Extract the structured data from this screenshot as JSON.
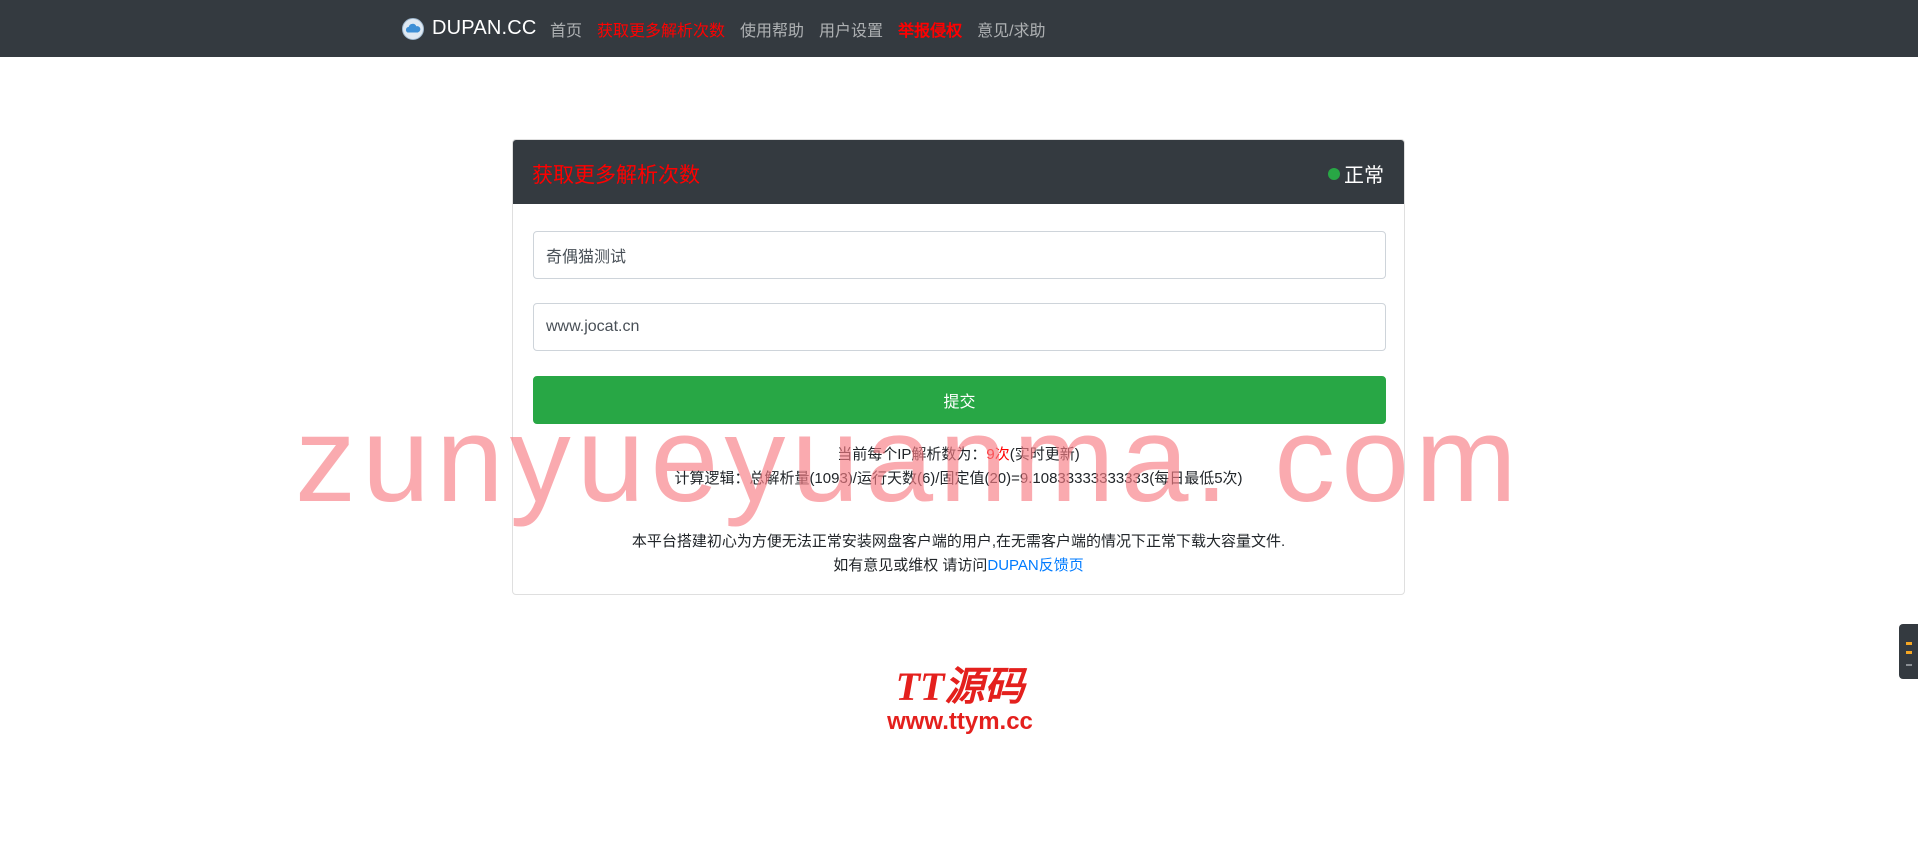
{
  "navbar": {
    "brand": "DUPAN.CC",
    "items": [
      {
        "label": "首页",
        "highlight": false
      },
      {
        "label": "获取更多解析次数",
        "highlight": true
      },
      {
        "label": "使用帮助",
        "highlight": false
      },
      {
        "label": "用户设置",
        "highlight": false
      },
      {
        "label": "举报侵权",
        "highlight": true
      },
      {
        "label": "意见/求助",
        "highlight": false
      }
    ]
  },
  "card": {
    "title": "获取更多解析次数",
    "status": "正常",
    "title_field_value": "奇偶猫测试",
    "url_field_value": "www.jocat.cn",
    "submit_label": "提交",
    "ip_line": {
      "prefix": "当前每个IP解析数为：",
      "count": "9次",
      "suffix": "(实时更新)"
    },
    "logic_line": "计算逻辑：总解析量(1093)/运行天数(6)/固定值(20)=9.10833333333333(每日最低5次)",
    "about_line": "本平台搭建初心为方便无法正常安装网盘客户端的用户,在无需客户端的情况下正常下载大容量文件.",
    "feedback": {
      "prefix": "如有意见或维权 请访问",
      "link_text": "DUPAN反馈页"
    }
  },
  "watermarks": {
    "overlay_text": "zunyueyuanma. com",
    "logo_main": "TT源码",
    "logo_url": "www.ttym.cc"
  },
  "colors": {
    "navbar_bg": "#343a40",
    "highlight_red": "#ff0000",
    "success_green": "#28a745",
    "link_blue": "#007bff"
  }
}
